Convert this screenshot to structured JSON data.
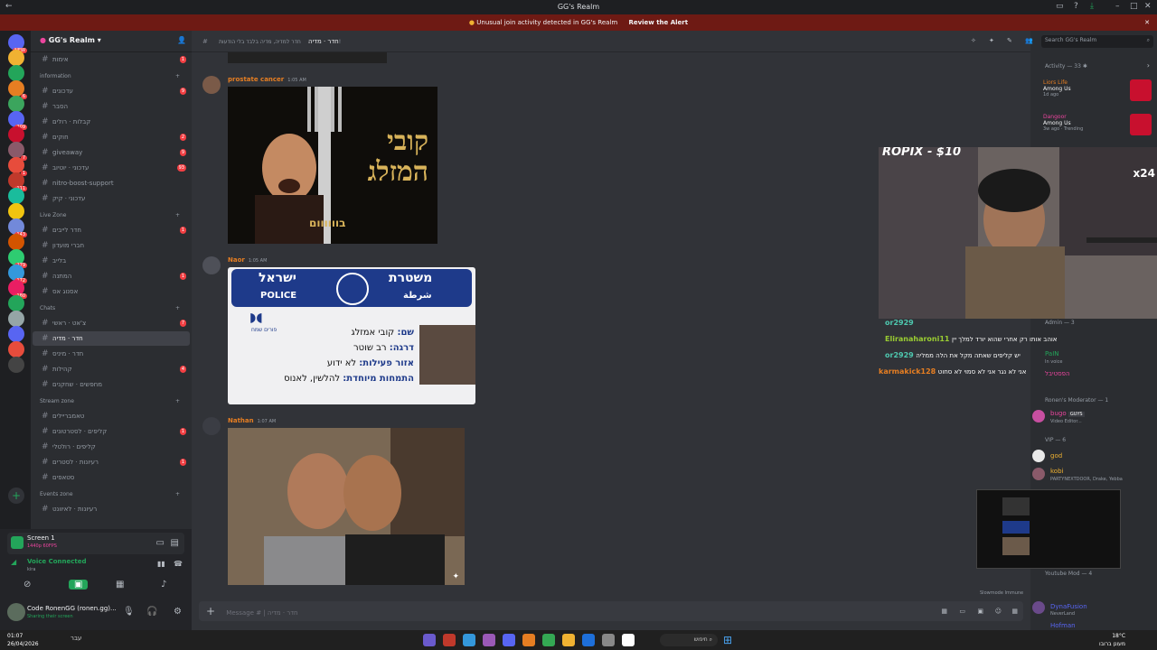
{
  "window": {
    "title": "GG's Realm"
  },
  "alert": {
    "text": "Unusual join activity detected in GG's Realm",
    "link": "Review the Alert"
  },
  "guild_badges": [
    "NEW",
    "6",
    "209",
    "7",
    "1",
    "111",
    "143",
    "279",
    "172",
    "180"
  ],
  "server": {
    "name": "GG's Realm"
  },
  "channels": [
    {
      "name": "אימות",
      "badge": "1"
    },
    {
      "cat": "information"
    },
    {
      "name": "עדכונים",
      "badge": "9"
    },
    {
      "name": "הסבר"
    },
    {
      "name": "קבלות · רולים",
      "badge": ""
    },
    {
      "name": "חוקים",
      "badge": "2"
    },
    {
      "name": "giveaway",
      "badge": "9"
    },
    {
      "name": "עדכוני · יוטיוב",
      "badge": "93"
    },
    {
      "name": "nitro-boost-support"
    },
    {
      "name": "עדכוני · קיק"
    },
    {
      "cat": "Live Zone"
    },
    {
      "name": "חדר לייבים",
      "badge": "1"
    },
    {
      "name": "חברי מועדון"
    },
    {
      "name": "בלייב"
    },
    {
      "name": "המתנה",
      "badge": "1"
    },
    {
      "name": "אסנוג אס"
    },
    {
      "cat": "Chats"
    },
    {
      "name": "צ'אט · ראשי",
      "badge": "7"
    },
    {
      "name": "חדר · מדיה",
      "sel": true
    },
    {
      "name": "חדר · מיניס"
    },
    {
      "name": "קהילות",
      "badge": "4"
    },
    {
      "name": "מחפשים · שחקנים"
    },
    {
      "cat": "Stream zone"
    },
    {
      "name": "טאמבריילים"
    },
    {
      "name": "קליפים · לסטרטונים",
      "badge": "1"
    },
    {
      "name": "קליפים · רולטלי"
    },
    {
      "name": "רעיונות · לסטרים",
      "badge": "1"
    },
    {
      "name": "סטאפים"
    },
    {
      "cat": "Events zone"
    },
    {
      "name": "רעיונות · לאיוונט"
    }
  ],
  "user_panel": {
    "screen_title": "Screen 1",
    "screen_sub": "1440p 60FPS",
    "voice_status": "Voice Connected",
    "voice_channel": "kira",
    "username": "Code RonenGG (ronen.gg)...",
    "user_status": "Sharing their screen"
  },
  "topbar": {
    "channel": "חדר · מדיה",
    "topic": "חדר למדיה, מדיה בלבד בלי הודעות!",
    "search": "Search GG's Realm"
  },
  "messages": [
    {
      "author": "prostate cancer",
      "time": "1:05 AM",
      "color": "#e67e22"
    },
    {
      "author": "Naor",
      "time": "1:05 AM",
      "color": "#e67e22"
    },
    {
      "author": "Nathan",
      "time": "1:07 AM",
      "color": "#e67e22"
    }
  ],
  "poster": {
    "line1": "קובי",
    "line2": "המזלג",
    "line3": "בוווווום"
  },
  "police_card": {
    "he_left": "ישראל",
    "en_left": "POLICE",
    "he_right": "משטרת",
    "ar_right": "شرطة",
    "sub_logo": "פורים שמח",
    "l1_label": "שם:",
    "l1_value": "קובי אמזלג",
    "l2_label": "דרגה:",
    "l2_value": "רב שוטר",
    "l3_label": "אזור פעילות:",
    "l3_value": "לא ידוע",
    "l4_label": "התמחות מיוחדת:",
    "l4_value": "להלשין, לאנוס"
  },
  "composer": {
    "placeholder": "Message # | חדר · מדיה"
  },
  "activity": {
    "title": "Activity — 33",
    "items": [
      {
        "user": "Liors Life",
        "game": "Among Us",
        "sub": "1d ago"
      },
      {
        "user": "Dangoor",
        "game": "Among Us",
        "sub": "3w ago · Trending"
      }
    ]
  },
  "stream": {
    "overlay": "ROPIX - $10",
    "multiplier": "x24"
  },
  "chat_overlay": [
    {
      "user": "or2929",
      "text": "",
      "color": "#4ec9b0"
    },
    {
      "user": "Eliranaharoni11",
      "text": "אוהב אותו רק אחרי שהוא יורד למלך יין",
      "color": "#9acd32"
    },
    {
      "user": "or2929",
      "text": "יש קליפים שאתה מקל את הלה ממליה",
      "color": "#4ec9b0"
    },
    {
      "user": "karmakick128",
      "text": "אני לא נגר אני לא סמוי לא סחוט",
      "color": "#e67e22"
    }
  ],
  "members": {
    "admin_header": "Admin — 3",
    "admins": [
      {
        "name": "PaIN",
        "sub": "In voice"
      },
      {
        "name": "הפסטיבל",
        "sub": ""
      }
    ],
    "mod_header": "Ronen's Moderator — 1",
    "mods": [
      {
        "name": "bugo",
        "tag": "GUYS",
        "sub": "Video Editor..."
      }
    ],
    "vip_header": "VIP — 6",
    "vips": [
      {
        "name": "god",
        "sub": ""
      },
      {
        "name": "kobi",
        "sub": "PARTYNEXTDOOR, Drake, Yebba"
      }
    ],
    "ytmod_header": "Youtube Mod — 4",
    "ytmods": [
      {
        "name": "DynaFusion",
        "sub": "NeverLand"
      },
      {
        "name": "Hofman",
        "sub": ""
      }
    ],
    "slowmode": "Slowmode Immune"
  },
  "taskbar": {
    "time": "01:07",
    "date": "26/04/2026",
    "weather": "18°C",
    "weather_sub": "מעונן ברובו",
    "search": "חיפוש",
    "lang": "עבר"
  },
  "colors": {
    "accent": "#5865f2",
    "alert_bg": "#6e1a14",
    "badge": "#f23f43",
    "green": "#23a55a"
  }
}
